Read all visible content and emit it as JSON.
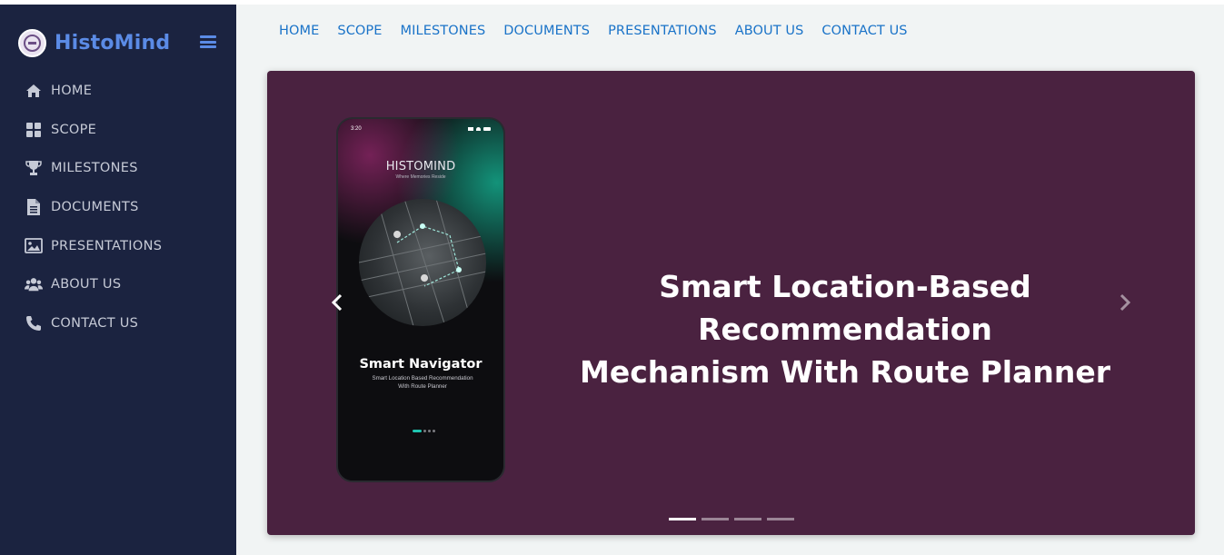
{
  "brand": {
    "name": "HistoMind",
    "logo_icon": "seal-logo-icon"
  },
  "sidebar": {
    "items": [
      {
        "label": "HOME",
        "icon": "home-icon"
      },
      {
        "label": "SCOPE",
        "icon": "grid-icon"
      },
      {
        "label": "MILESTONES",
        "icon": "trophy-icon"
      },
      {
        "label": "DOCUMENTS",
        "icon": "document-icon"
      },
      {
        "label": "PRESENTATIONS",
        "icon": "image-icon"
      },
      {
        "label": "ABOUT US",
        "icon": "users-icon"
      },
      {
        "label": "CONTACT US",
        "icon": "phone-icon"
      }
    ]
  },
  "topnav": {
    "items": [
      "HOME",
      "SCOPE",
      "MILESTONES",
      "DOCUMENTS",
      "PRESENTATIONS",
      "ABOUT US",
      "CONTACT US"
    ]
  },
  "carousel": {
    "title_line1": "Smart Location-Based Recommendation",
    "title_line2": "Mechanism With Route Planner",
    "indicator_count": 4,
    "active_index": 0,
    "phone": {
      "time": "3:20",
      "brand": "HISTOMIND",
      "tagline": "Where Memories Reside",
      "app_title": "Smart Navigator",
      "app_subtitle_line1": "Smart Location Based Recommendation",
      "app_subtitle_line2": "With Route Planner"
    }
  },
  "colors": {
    "sidebar_bg": "#1b2340",
    "brand_blue": "#5b8be6",
    "nav_link": "#1a73c8",
    "slide_bg": "#4a2240",
    "page_bg": "#f1f4f4"
  }
}
